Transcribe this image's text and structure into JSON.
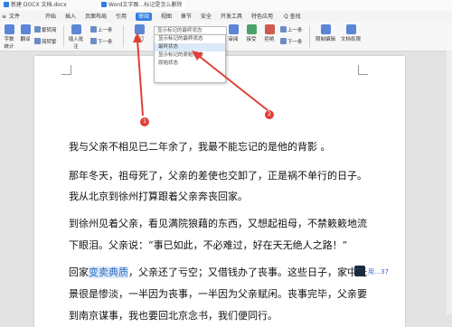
{
  "tabs": [
    {
      "label": "新建 DOCX 文档.docx"
    },
    {
      "label": "Word文字跟…标记是怎么删除"
    }
  ],
  "menu": [
    "文件",
    "开始",
    "插入",
    "页面布局",
    "引用",
    "审阅",
    "视图",
    "章节",
    "安全",
    "开发工具",
    "特色应用"
  ],
  "menu_active": "审阅",
  "search": "Q 查找",
  "ribbon": {
    "word_count": "字数统计",
    "translate": "翻译",
    "simplify": "繁转简",
    "simp_to_trad": "简转繁",
    "insert_comment": "插入批注",
    "prev": "上一条",
    "next": "下一条",
    "revise": "修订",
    "review": "审阅",
    "accept": "接受",
    "reject": "拒绝",
    "prev2": "上一条",
    "next2": "下一条",
    "restrict": "限制编辑",
    "doc_rights": "文档权限"
  },
  "dropdown": {
    "selected": "显示标记的最终状态",
    "items": [
      "显示标记的最终状态",
      "最终状态",
      "显示标记的原始状态",
      "原始状态"
    ]
  },
  "annotations": [
    "1",
    "2"
  ],
  "document": {
    "p1": "我与父亲不相见已二年余了，我最不能忘记的是他的背影 。",
    "p2a": "那年冬天，祖母死了，父亲的差使也交卸了，正是祸不单行的日子。",
    "p2b": "我从北京到徐州打算跟着父亲奔丧回家。",
    "p3a": "到徐州见着父亲，看见满院狼藉的东西，又想起祖母，不禁簌簌地流",
    "p3b": "下眼泪。父亲说：“事已如此，不必难过，好在天无绝人之路！”",
    "p4a_pre": "回家",
    "p4a_hl": "变卖典质",
    "p4a_post": "，父亲还了亏空；又借钱办了丧事。这些日子，家中光",
    "p4b": "景很是惨淡，一半因为丧事，一半因为父亲赋闲。丧事完毕，父亲要",
    "p4c": "到南京谋事，我也要回北京念书，我们便同行。"
  },
  "reviewer": "用…37"
}
